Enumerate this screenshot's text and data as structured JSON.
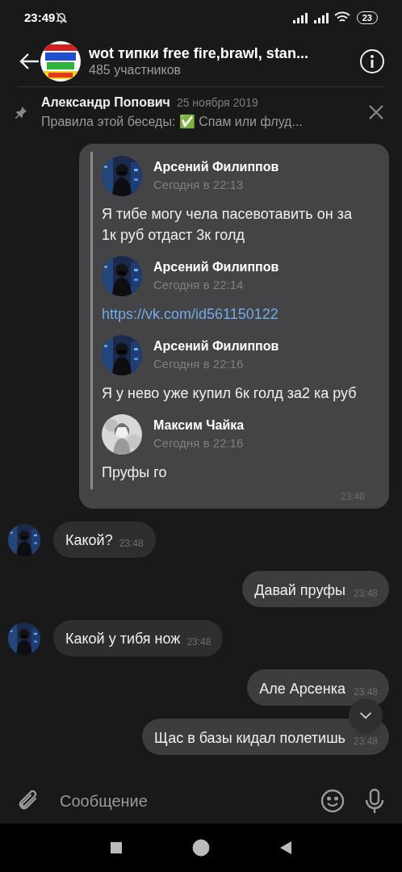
{
  "status_bar": {
    "time": "23:49",
    "battery": "23"
  },
  "header": {
    "title": "wot типки free fire,brawl, stan...",
    "subtitle": "485 участников"
  },
  "pinned": {
    "author": "Александр Попович",
    "date": "25 ноября 2019",
    "text": "Правила этой беседы: ✅ Спам или флуд..."
  },
  "messages": [
    {
      "kind": "forward",
      "time": "23:48",
      "items": [
        {
          "author": "Арсений Филиппов",
          "time": "Сегодня в 22:13",
          "kind": "text",
          "text": "Я тибе могу чела пасевотавить он за 1к руб отдаст 3к голд"
        },
        {
          "author": "Арсений Филиппов",
          "time": "Сегодня в 22:14",
          "kind": "link",
          "text": "https://vk.com/id561150122"
        },
        {
          "author": "Арсений Филиппов",
          "time": "Сегодня в 22:16",
          "kind": "text",
          "text": "Я у нево уже купил 6к голд за2 ка руб"
        },
        {
          "author": "Максим Чайка",
          "time": "Сегодня в 22:16",
          "kind": "text",
          "text": "Пруфы го"
        }
      ]
    },
    {
      "kind": "incoming",
      "text": "Какой?",
      "time": "23:48"
    },
    {
      "kind": "outgoing",
      "text": "Давай пруфы",
      "time": "23:48"
    },
    {
      "kind": "incoming",
      "text": "Какой у тибя нож",
      "time": "23:48"
    },
    {
      "kind": "outgoing",
      "text": "Але Арсенка",
      "time": "23:48"
    },
    {
      "kind": "outgoing",
      "text": "Щас в базы кидал полетишь",
      "time": "23:48"
    }
  ],
  "composer": {
    "placeholder": "Сообщение"
  }
}
